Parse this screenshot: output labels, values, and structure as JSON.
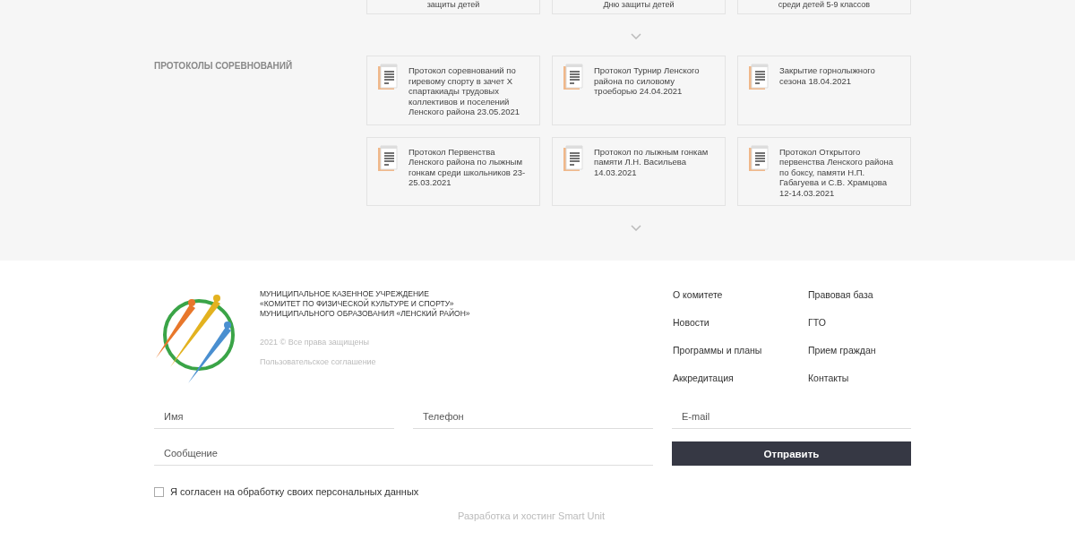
{
  "top_cards": [
    {
      "title": "защиты детей"
    },
    {
      "title": "Дню защиты детей"
    },
    {
      "title": "среди детей 5-9 классов"
    }
  ],
  "protocols": {
    "heading": "ПРОТОКОЛЫ СОРЕВНОВАНИЙ",
    "cards": [
      {
        "title": "Протокол соревнований по гиревому спорту в зачет X спартакиады трудовых коллективов и поселений Ленского района 23.05.2021"
      },
      {
        "title": "Протокол Турнир Ленского района по силовому троеборью 24.04.2021"
      },
      {
        "title": "Закрытие горнолыжного сезона 18.04.2021"
      },
      {
        "title": "Протокол Первенства Ленского района по лыжным гонкам среди школьников 23-25.03.2021"
      },
      {
        "title": "Протокол по лыжным гонкам памяти Л.Н. Васильева 14.03.2021"
      },
      {
        "title": "Протокол Открытого первенства Ленского района по боксу, памяти Н.П. Габагуева и С.В. Храмцова 12-14.03.2021"
      }
    ]
  },
  "footer": {
    "org_lines": [
      "МУНИЦИПАЛЬНОЕ КАЗЕННОЕ УЧРЕЖДЕНИЕ",
      "«КОМИТЕТ ПО ФИЗИЧЕСКОЙ КУЛЬТУРЕ И СПОРТУ»",
      "МУНИЦИПАЛЬНОГО ОБРАЗОВАНИЯ «ЛЕНСКИЙ РАЙОН»"
    ],
    "copyright": "2021 © Все права защищены",
    "agreement": "Пользовательское соглашение",
    "links": [
      "О комитете",
      "Правовая база",
      "Новости",
      "ГТО",
      "Программы и планы",
      "Прием граждан",
      "Аккредитация",
      "Контакты"
    ]
  },
  "form": {
    "name": {
      "placeholder": "Имя"
    },
    "phone": {
      "placeholder": "Телефон"
    },
    "email": {
      "placeholder": "E-mail"
    },
    "message": {
      "placeholder": "Сообщение"
    },
    "submit": "Отправить",
    "consent": {
      "label": "Я согласен на обработку своих персональных данных",
      "checked": false
    }
  },
  "credit": "Разработка и хостинг Smart Unit"
}
